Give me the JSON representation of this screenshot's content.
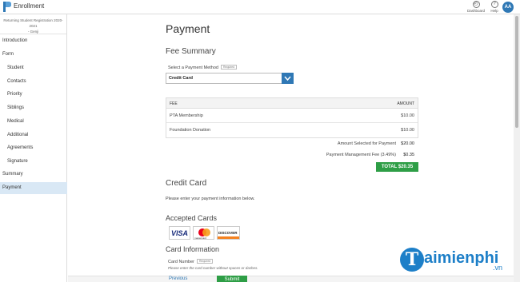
{
  "app": {
    "title": "Enrollment"
  },
  "header": {
    "dashboard_label": "Dashboard",
    "help_label": "Help",
    "avatar_initials": "AA"
  },
  "sidebar": {
    "subtitle_line1": "Returning Student Registration 2020-2021",
    "subtitle_line2": "- Genji",
    "items": [
      {
        "label": "Introduction"
      },
      {
        "label": "Form"
      },
      {
        "label": "Student"
      },
      {
        "label": "Contacts"
      },
      {
        "label": "Priority"
      },
      {
        "label": "Siblings"
      },
      {
        "label": "Medical"
      },
      {
        "label": "Additional"
      },
      {
        "label": "Agreements"
      },
      {
        "label": "Signature"
      },
      {
        "label": "Summary"
      },
      {
        "label": "Payment"
      }
    ]
  },
  "page": {
    "title": "Payment",
    "fee_summary_title": "Fee Summary",
    "payment_method_label": "Select a Payment Method",
    "required_label": "Required",
    "payment_method_value": "Credit Card",
    "table": {
      "col_fee": "FEE",
      "col_amount": "AMOUNT",
      "rows": [
        {
          "name": "PTA Membership",
          "amount": "$10.00"
        },
        {
          "name": "Foundation Donation",
          "amount": "$10.00"
        }
      ]
    },
    "amount_selected_label": "Amount Selected for Payment",
    "amount_selected_value": "$20.00",
    "management_fee_label": "Payment Management Fee (3.49%)",
    "management_fee_value": "$0.35",
    "total_label": "TOTAL $20.35",
    "credit_card_title": "Credit Card",
    "credit_card_instructions": "Please enter your payment information below.",
    "accepted_cards_title": "Accepted Cards",
    "cards": [
      "VISA",
      "mastercard",
      "DISCOVER"
    ],
    "card_info_title": "Card Information",
    "card_number_label": "Card Number",
    "card_number_hint": "Please enter the card number without spaces or dashes.",
    "previous_label": "Previous",
    "submit_label": "Submit"
  },
  "watermark": {
    "text": "aimienphi",
    "letter": "T",
    "suffix": ".vn"
  },
  "colors": {
    "accent": "#2f78b5",
    "success": "#2e9e46",
    "active_sidebar": "#d9e8f5",
    "watermark": "#1d7fc8"
  }
}
